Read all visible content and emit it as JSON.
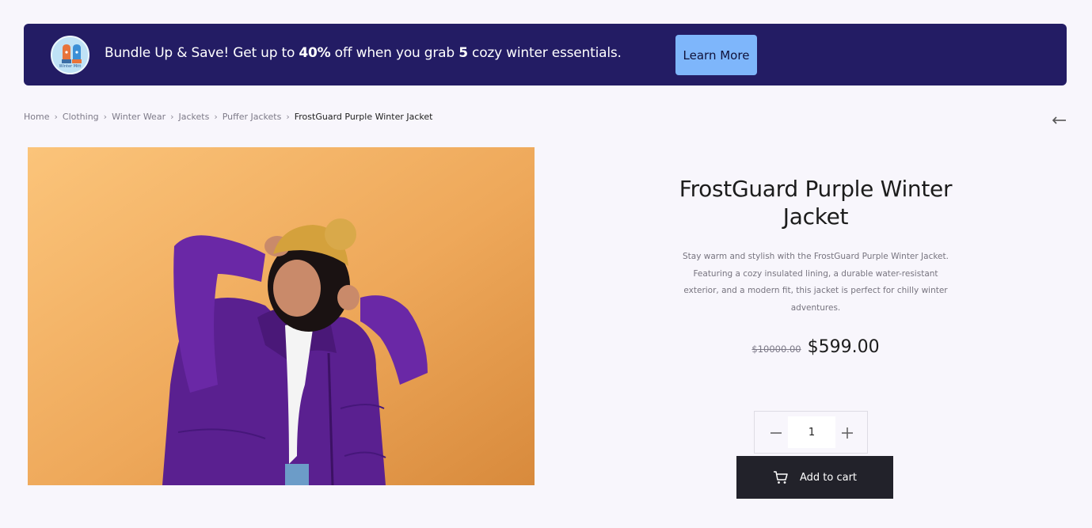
{
  "promo": {
    "text_before": "Bundle Up & Save! Get up to ",
    "discount": "40%",
    "text_middle": " off when you grab ",
    "count": "5",
    "text_after": " cozy winter essentials.",
    "badge_label": "Winter Mitt",
    "button_label": "Learn More",
    "colors": {
      "background": "#231c64",
      "button": "#7eb6fb"
    }
  },
  "breadcrumb": {
    "items": [
      "Home",
      "Clothing",
      "Winter Wear",
      "Jackets",
      "Puffer Jackets"
    ],
    "current": "FrostGuard Purple Winter Jacket",
    "separator": "›"
  },
  "product": {
    "title": "FrostGuard Purple Winter Jacket",
    "description": "Stay warm and stylish with the FrostGuard Purple Winter Jacket. Featuring a cozy insulated lining, a durable water-resistant exterior, and a modern fit, this jacket is perfect for chilly winter adventures.",
    "old_price": "$10000.00",
    "price": "$599.00",
    "quantity": "1",
    "add_to_cart_label": "Add to cart",
    "image_icon": "photo-woman-purple-puffer-jacket",
    "colors": {
      "image_background": "#eea85a",
      "jacket": "#5a2090",
      "hat": "#d4a13c"
    }
  },
  "icons": {
    "back": "arrow-left-icon",
    "cart": "cart-icon",
    "minus": "minus-icon",
    "plus": "plus-icon",
    "chevron": "chevron-right-icon"
  }
}
